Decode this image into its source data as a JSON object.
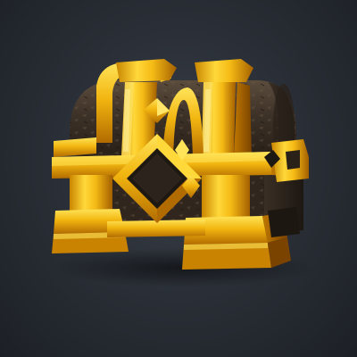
{
  "asset": {
    "icon": "treasure-chest-icon",
    "material_primary": "gold",
    "material_secondary": "dark-wood"
  },
  "colors": {
    "background_center": "#3a4049",
    "background_edge": "#1c2026",
    "gold_light": "#ffe45a",
    "gold_mid": "#f2b610",
    "gold_dark": "#b26b00",
    "gold_shadow": "#7a4300",
    "wood_light": "#5b4c3c",
    "wood_dark": "#2a2119",
    "gem_frame": "#1e1813"
  }
}
